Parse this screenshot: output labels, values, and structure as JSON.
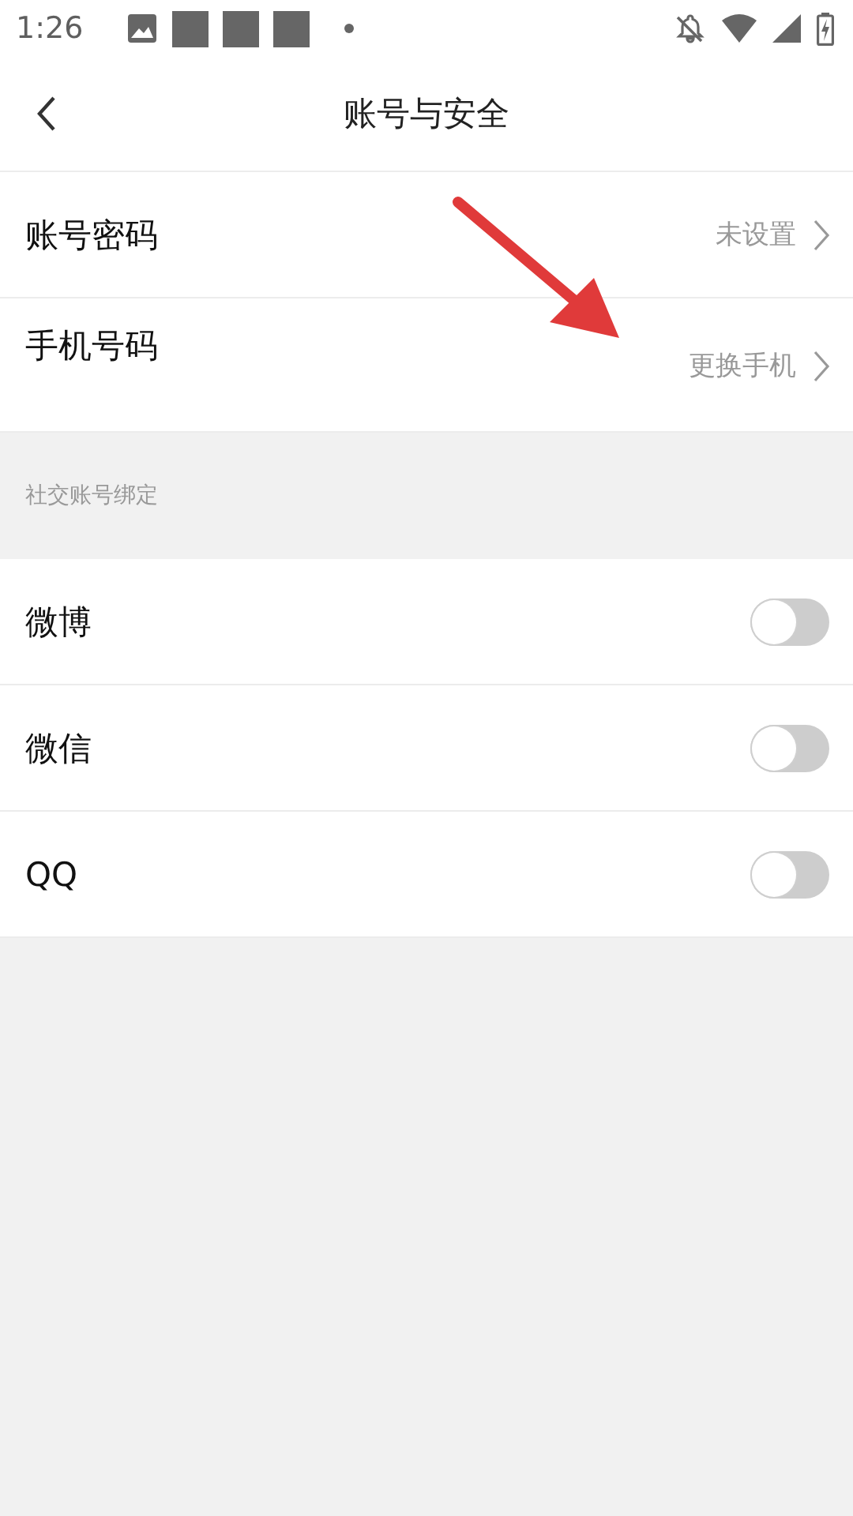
{
  "status_bar": {
    "time": "1:26"
  },
  "nav": {
    "title": "账号与安全"
  },
  "account_rows": [
    {
      "label": "账号密码",
      "value": "未设置"
    },
    {
      "label": "手机号码",
      "value": "更换手机"
    }
  ],
  "social_section": {
    "title": "社交账号绑定",
    "items": [
      {
        "label": "微博",
        "on": false
      },
      {
        "label": "微信",
        "on": false
      },
      {
        "label": "QQ",
        "on": false
      }
    ]
  }
}
